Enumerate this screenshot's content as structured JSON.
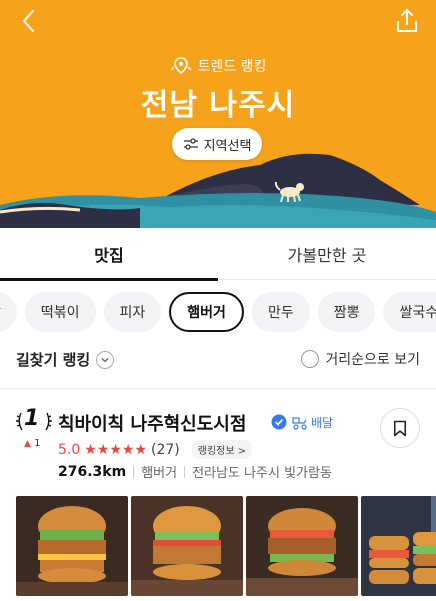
{
  "header": {
    "trend_label": "트렌드 랭킹",
    "region_title": "전남 나주시",
    "region_select_label": "지역선택"
  },
  "tabs": [
    {
      "label": "맛집",
      "active": true
    },
    {
      "label": "가볼만한 곳",
      "active": false
    }
  ],
  "chips": [
    {
      "label": "밥",
      "active": false
    },
    {
      "label": "떡볶이",
      "active": false
    },
    {
      "label": "피자",
      "active": false
    },
    {
      "label": "햄버거",
      "active": true
    },
    {
      "label": "만두",
      "active": false
    },
    {
      "label": "짬뽕",
      "active": false
    },
    {
      "label": "쌀국수",
      "active": false
    }
  ],
  "filters": {
    "sort_label": "길찾기 랭킹",
    "distance_sort_label": "거리순으로 보기"
  },
  "restaurant": {
    "rank": "1",
    "rank_change": "1",
    "name": "칙바이칙 나주혁신도시점",
    "delivery_label": "배달",
    "score": "5.0",
    "stars": "★★★★★",
    "review_count": "(27)",
    "info_label": "랭킹정보 >",
    "distance": "276.3km",
    "category": "햄버거",
    "address": "전라남도 나주시 빛가람동"
  },
  "icons": {
    "back": "back-arrow-icon",
    "share": "share-icon",
    "pin": "location-pin-icon",
    "filter": "sliders-icon",
    "verified": "verified-check-icon",
    "delivery": "scooter-icon",
    "bookmark": "bookmark-icon"
  },
  "colors": {
    "hero_orange": "#f7a21b",
    "accent_red": "#e8473f",
    "delivery_blue": "#3478f6"
  }
}
